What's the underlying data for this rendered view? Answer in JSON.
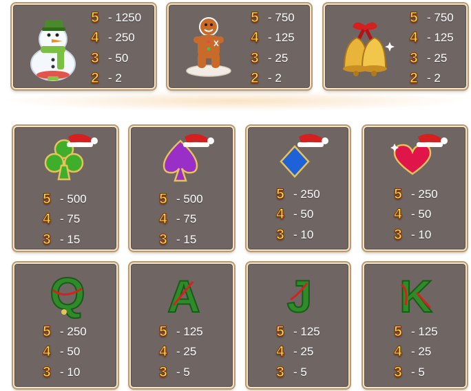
{
  "paytable": {
    "top": [
      {
        "symbol": "snowman-icon",
        "pays": [
          {
            "count": "5",
            "value": "- 1250"
          },
          {
            "count": "4",
            "value": "- 250"
          },
          {
            "count": "3",
            "value": "- 50"
          },
          {
            "count": "2",
            "value": "- 2"
          }
        ]
      },
      {
        "symbol": "gingerbread-man-icon",
        "pays": [
          {
            "count": "5",
            "value": "- 750"
          },
          {
            "count": "4",
            "value": "- 125"
          },
          {
            "count": "3",
            "value": "- 25"
          },
          {
            "count": "2",
            "value": "- 2"
          }
        ]
      },
      {
        "symbol": "bells-icon",
        "pays": [
          {
            "count": "5",
            "value": "- 750"
          },
          {
            "count": "4",
            "value": "- 125"
          },
          {
            "count": "3",
            "value": "- 25"
          },
          {
            "count": "2",
            "value": "- 2"
          }
        ]
      }
    ],
    "suits": [
      {
        "symbol": "club-icon",
        "pays": [
          {
            "count": "5",
            "value": "- 500"
          },
          {
            "count": "4",
            "value": "- 75"
          },
          {
            "count": "3",
            "value": "- 15"
          }
        ]
      },
      {
        "symbol": "spade-icon",
        "pays": [
          {
            "count": "5",
            "value": "- 500"
          },
          {
            "count": "4",
            "value": "- 75"
          },
          {
            "count": "3",
            "value": "- 15"
          }
        ]
      },
      {
        "symbol": "diamond-icon",
        "pays": [
          {
            "count": "5",
            "value": "- 250"
          },
          {
            "count": "4",
            "value": "- 50"
          },
          {
            "count": "3",
            "value": "- 10"
          }
        ]
      },
      {
        "symbol": "heart-icon",
        "pays": [
          {
            "count": "5",
            "value": "- 250"
          },
          {
            "count": "4",
            "value": "- 50"
          },
          {
            "count": "3",
            "value": "- 10"
          }
        ]
      }
    ],
    "letters": [
      {
        "symbol": "Q",
        "pays": [
          {
            "count": "5",
            "value": "- 250"
          },
          {
            "count": "4",
            "value": "- 50"
          },
          {
            "count": "3",
            "value": "- 10"
          }
        ]
      },
      {
        "symbol": "A",
        "pays": [
          {
            "count": "5",
            "value": "- 125"
          },
          {
            "count": "4",
            "value": "- 25"
          },
          {
            "count": "3",
            "value": "- 5"
          }
        ]
      },
      {
        "symbol": "J",
        "pays": [
          {
            "count": "5",
            "value": "- 125"
          },
          {
            "count": "4",
            "value": "- 25"
          },
          {
            "count": "3",
            "value": "- 5"
          }
        ]
      },
      {
        "symbol": "K",
        "pays": [
          {
            "count": "5",
            "value": "- 125"
          },
          {
            "count": "4",
            "value": "- 25"
          },
          {
            "count": "3",
            "value": "- 5"
          }
        ]
      }
    ]
  },
  "colors": {
    "card_bg": "#6f6563",
    "multiplier": "#ffd94a",
    "garland_green": "#2f8a2a",
    "ribbon_red": "#d62020"
  }
}
